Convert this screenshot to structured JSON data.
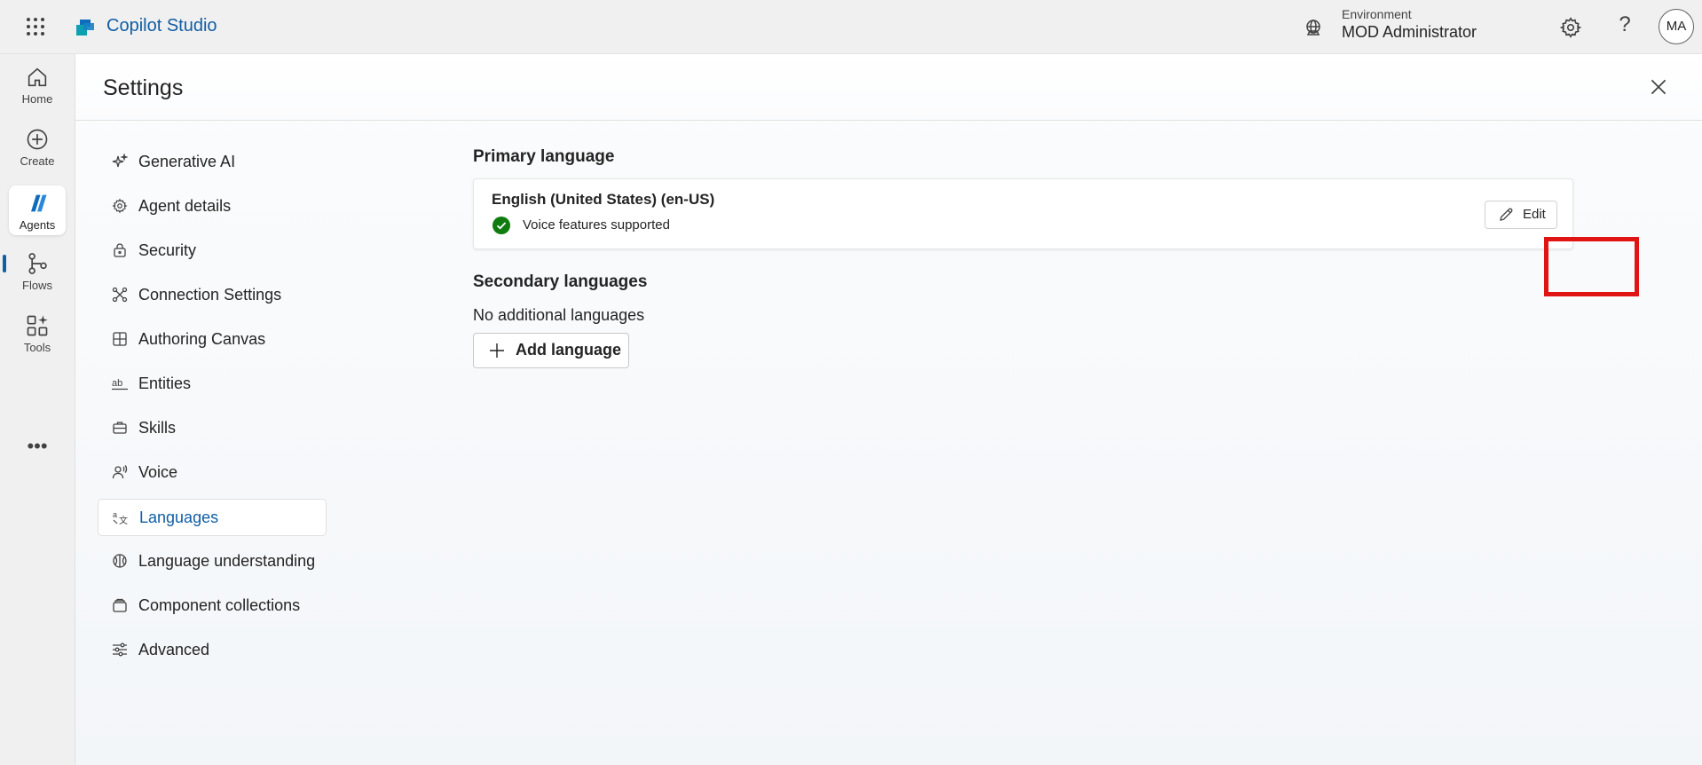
{
  "app": {
    "name": "Copilot Studio",
    "brand_color": "#115ea3"
  },
  "topbar": {
    "environment_label": "Environment",
    "environment_name": "MOD Administrator",
    "avatar_initials": "MA",
    "help_glyph": "?"
  },
  "rail": {
    "items": [
      {
        "label": "Home",
        "icon": "home-icon"
      },
      {
        "label": "Create",
        "icon": "plus-circle-icon"
      },
      {
        "label": "Agents",
        "icon": "agents-icon",
        "active": true
      },
      {
        "label": "Flows",
        "icon": "flows-icon"
      },
      {
        "label": "Tools",
        "icon": "tools-icon"
      }
    ],
    "more_glyph": "•••"
  },
  "page": {
    "title": "Settings"
  },
  "settings_nav": {
    "items": [
      {
        "label": "Generative AI",
        "icon": "sparkle-icon"
      },
      {
        "label": "Agent details",
        "icon": "gear-icon"
      },
      {
        "label": "Security",
        "icon": "lock-icon"
      },
      {
        "label": "Connection Settings",
        "icon": "connection-icon"
      },
      {
        "label": "Authoring Canvas",
        "icon": "grid-icon"
      },
      {
        "label": "Entities",
        "icon": "entities-icon"
      },
      {
        "label": "Skills",
        "icon": "briefcase-icon"
      },
      {
        "label": "Voice",
        "icon": "voice-icon"
      },
      {
        "label": "Languages",
        "icon": "translate-icon",
        "active": true
      },
      {
        "label": "Language understanding",
        "icon": "brain-icon"
      },
      {
        "label": "Component collections",
        "icon": "collection-icon"
      },
      {
        "label": "Advanced",
        "icon": "sliders-icon"
      }
    ]
  },
  "primary": {
    "heading": "Primary language",
    "language": "English (United States) (en-US)",
    "status": "Voice features supported",
    "edit_label": "Edit"
  },
  "secondary": {
    "heading": "Secondary languages",
    "empty_text": "No additional languages",
    "add_label": "Add language"
  }
}
